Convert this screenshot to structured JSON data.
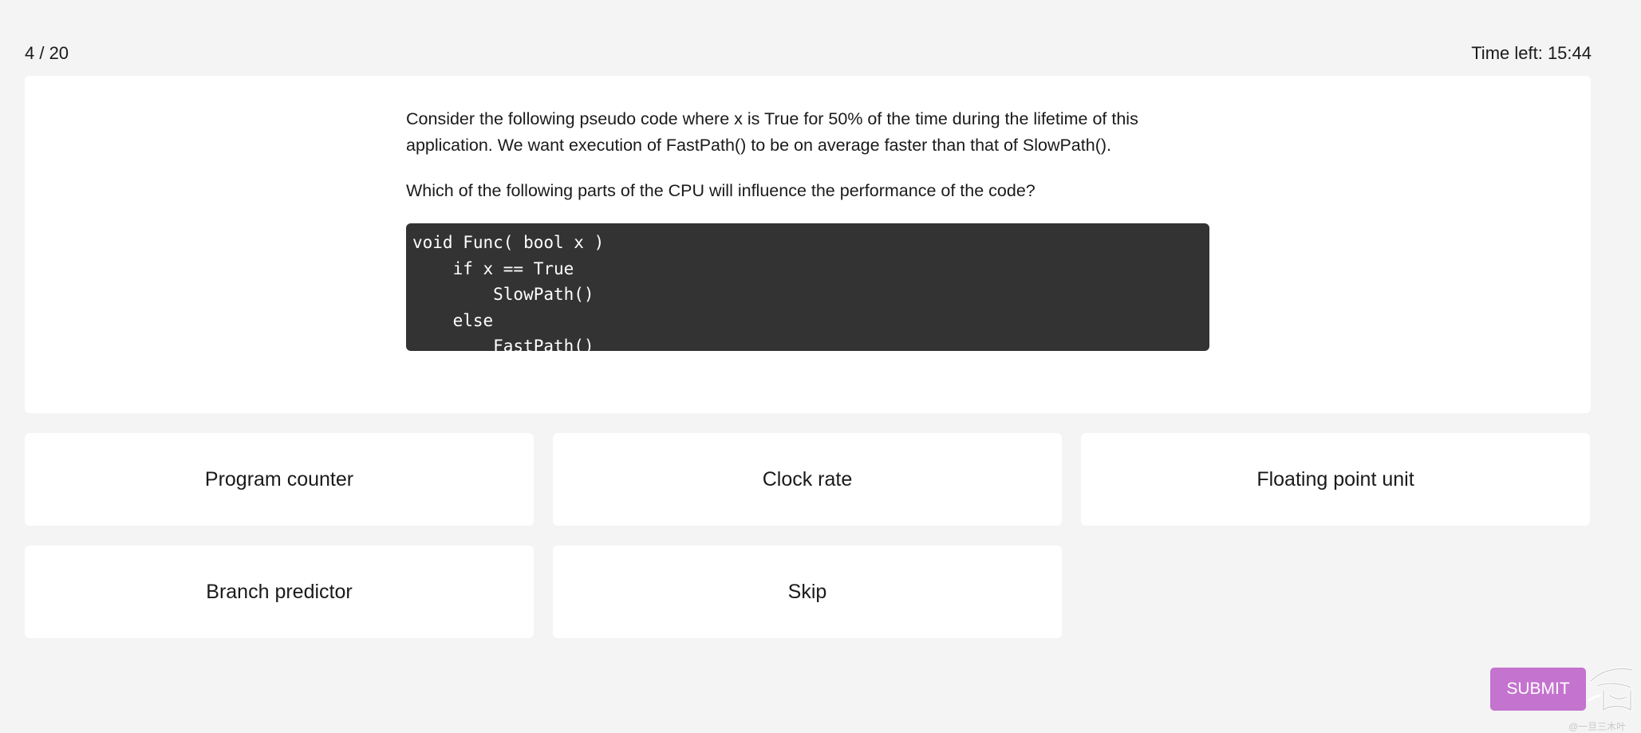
{
  "header": {
    "progress": "4 / 20",
    "timer": "Time left: 15:44"
  },
  "question": {
    "paragraphs": [
      "Consider the following pseudo code where x is True for 50% of the time during the lifetime of this application. We want execution of FastPath() to be on average faster than that of SlowPath().",
      "Which of the following parts of the CPU will influence the performance of the code?"
    ],
    "code_lines": [
      "void Func( bool x )",
      "    if x == True",
      "        SlowPath()",
      "    else",
      "        FastPath()"
    ]
  },
  "answers": [
    {
      "label": "Program counter"
    },
    {
      "label": "Clock rate"
    },
    {
      "label": "Floating point unit"
    },
    {
      "label": "Branch predictor"
    },
    {
      "label": "Skip"
    }
  ],
  "submit_label": "SUBMIT",
  "watermark_text": "@一旦三木叶",
  "colors": {
    "page_bg": "#f4f4f4",
    "card_bg": "#ffffff",
    "code_bg": "#333333",
    "submit_bg": "#c473cf"
  }
}
